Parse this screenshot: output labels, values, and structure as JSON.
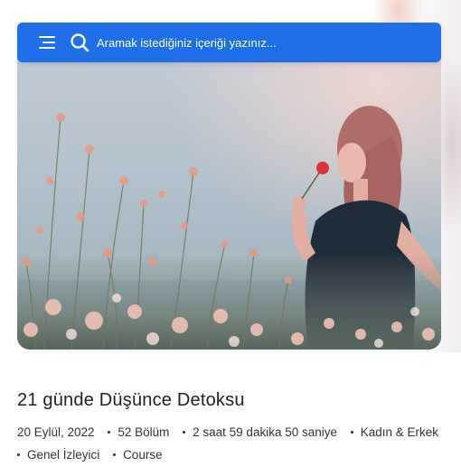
{
  "search": {
    "placeholder": "Aramak istediğiniz içeriği yazınız..."
  },
  "course": {
    "title": "21 günde Düşünce Detoksu",
    "date": "20 Eylül, 2022",
    "episodes": "52 Bölüm",
    "duration": "2 saat 59 dakika 50 saniye",
    "audience_gender": "Kadın & Erkek",
    "audience_type": "Genel İzleyici",
    "format": "Course"
  },
  "colors": {
    "accent": "#1e6fe8",
    "text": "#222222"
  },
  "icons": {
    "menu": "hamburger-menu-icon",
    "search": "search-icon"
  }
}
